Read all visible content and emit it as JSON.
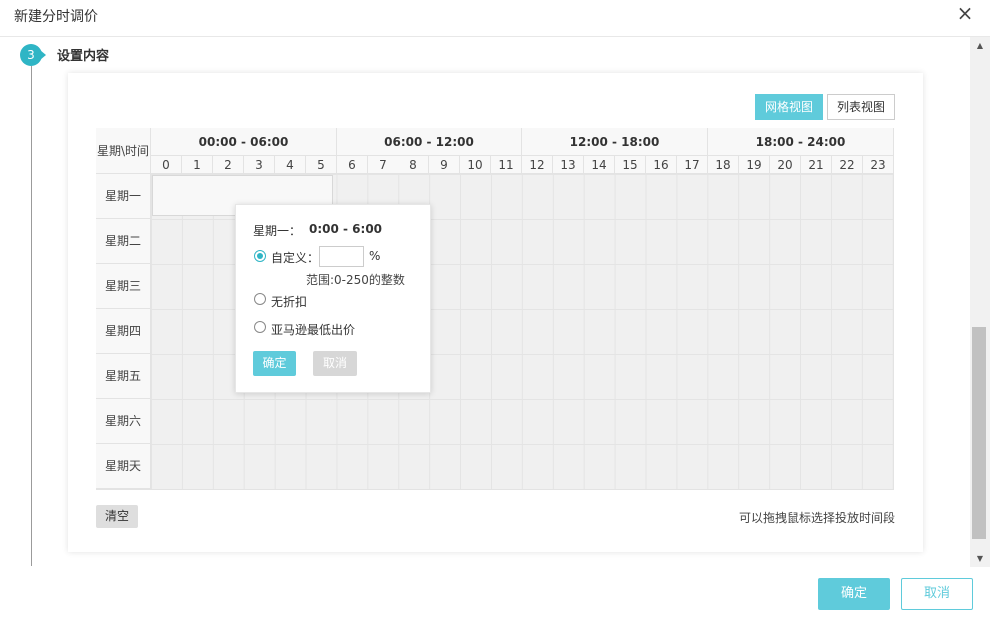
{
  "dialog": {
    "title": "新建分时调价",
    "close_icon": "×"
  },
  "step": {
    "number": "3",
    "title": "设置内容"
  },
  "view_toggle": {
    "grid": "网格视图",
    "list": "列表视图"
  },
  "table": {
    "corner_label": "星期\\时间",
    "ranges": [
      "00:00 - 06:00",
      "06:00 - 12:00",
      "12:00 - 18:00",
      "18:00 - 24:00"
    ],
    "hours": [
      "0",
      "1",
      "2",
      "3",
      "4",
      "5",
      "6",
      "7",
      "8",
      "9",
      "10",
      "11",
      "12",
      "13",
      "14",
      "15",
      "16",
      "17",
      "18",
      "19",
      "20",
      "21",
      "22",
      "23"
    ],
    "days": [
      "星期一",
      "星期二",
      "星期三",
      "星期四",
      "星期五",
      "星期六",
      "星期天"
    ]
  },
  "popup": {
    "day": "星期一：",
    "range": "0:00 - 6:00",
    "option_custom": "自定义：",
    "custom_value": "",
    "percent_sign": "%",
    "range_hint": "范围:0-250的整数",
    "option_no_discount": "无折扣",
    "option_amazon_lowest": "亚马逊最低出价",
    "ok": "确定",
    "cancel": "取消"
  },
  "footer": {
    "clear": "清空",
    "drag_hint": "可以拖拽鼠标选择投放时间段",
    "ok": "确定",
    "cancel": "取消"
  },
  "colors": {
    "accent": "#5fcbdb",
    "step": "#2fb5c5"
  }
}
